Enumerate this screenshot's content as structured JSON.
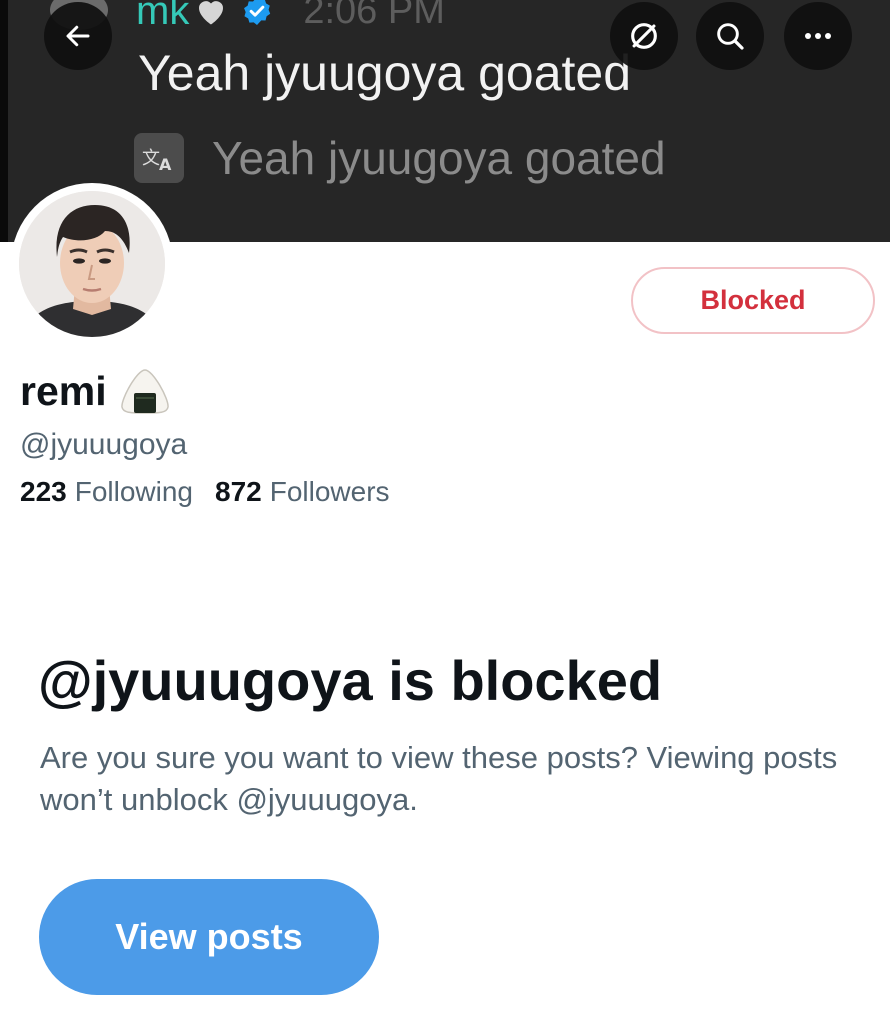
{
  "banner": {
    "author": "mk",
    "time": "2:06 PM",
    "text": "Yeah jyuugoya goated",
    "translation": "Yeah jyuugoya goated",
    "icons": [
      "back-arrow-icon",
      "no-image-icon",
      "search-icon",
      "more-icon",
      "translate-icon",
      "verified-icon",
      "heart-icon"
    ]
  },
  "profile": {
    "display_name": "remi",
    "name_emoji": "onigiri-icon",
    "handle": "@jyuuugoya",
    "following_count": "223",
    "following_label": "Following",
    "followers_count": "872",
    "followers_label": "Followers",
    "blocked_label": "Blocked"
  },
  "blocked_notice": {
    "title": "@jyuuugoya is blocked",
    "description": "Are you sure you want to view these posts? Viewing posts won’t unblock @jyuuugoya.",
    "button_label": "View posts"
  },
  "colors": {
    "accent": "#4c9be8",
    "blocked_red": "#d3303d",
    "secondary_text": "#536471"
  }
}
